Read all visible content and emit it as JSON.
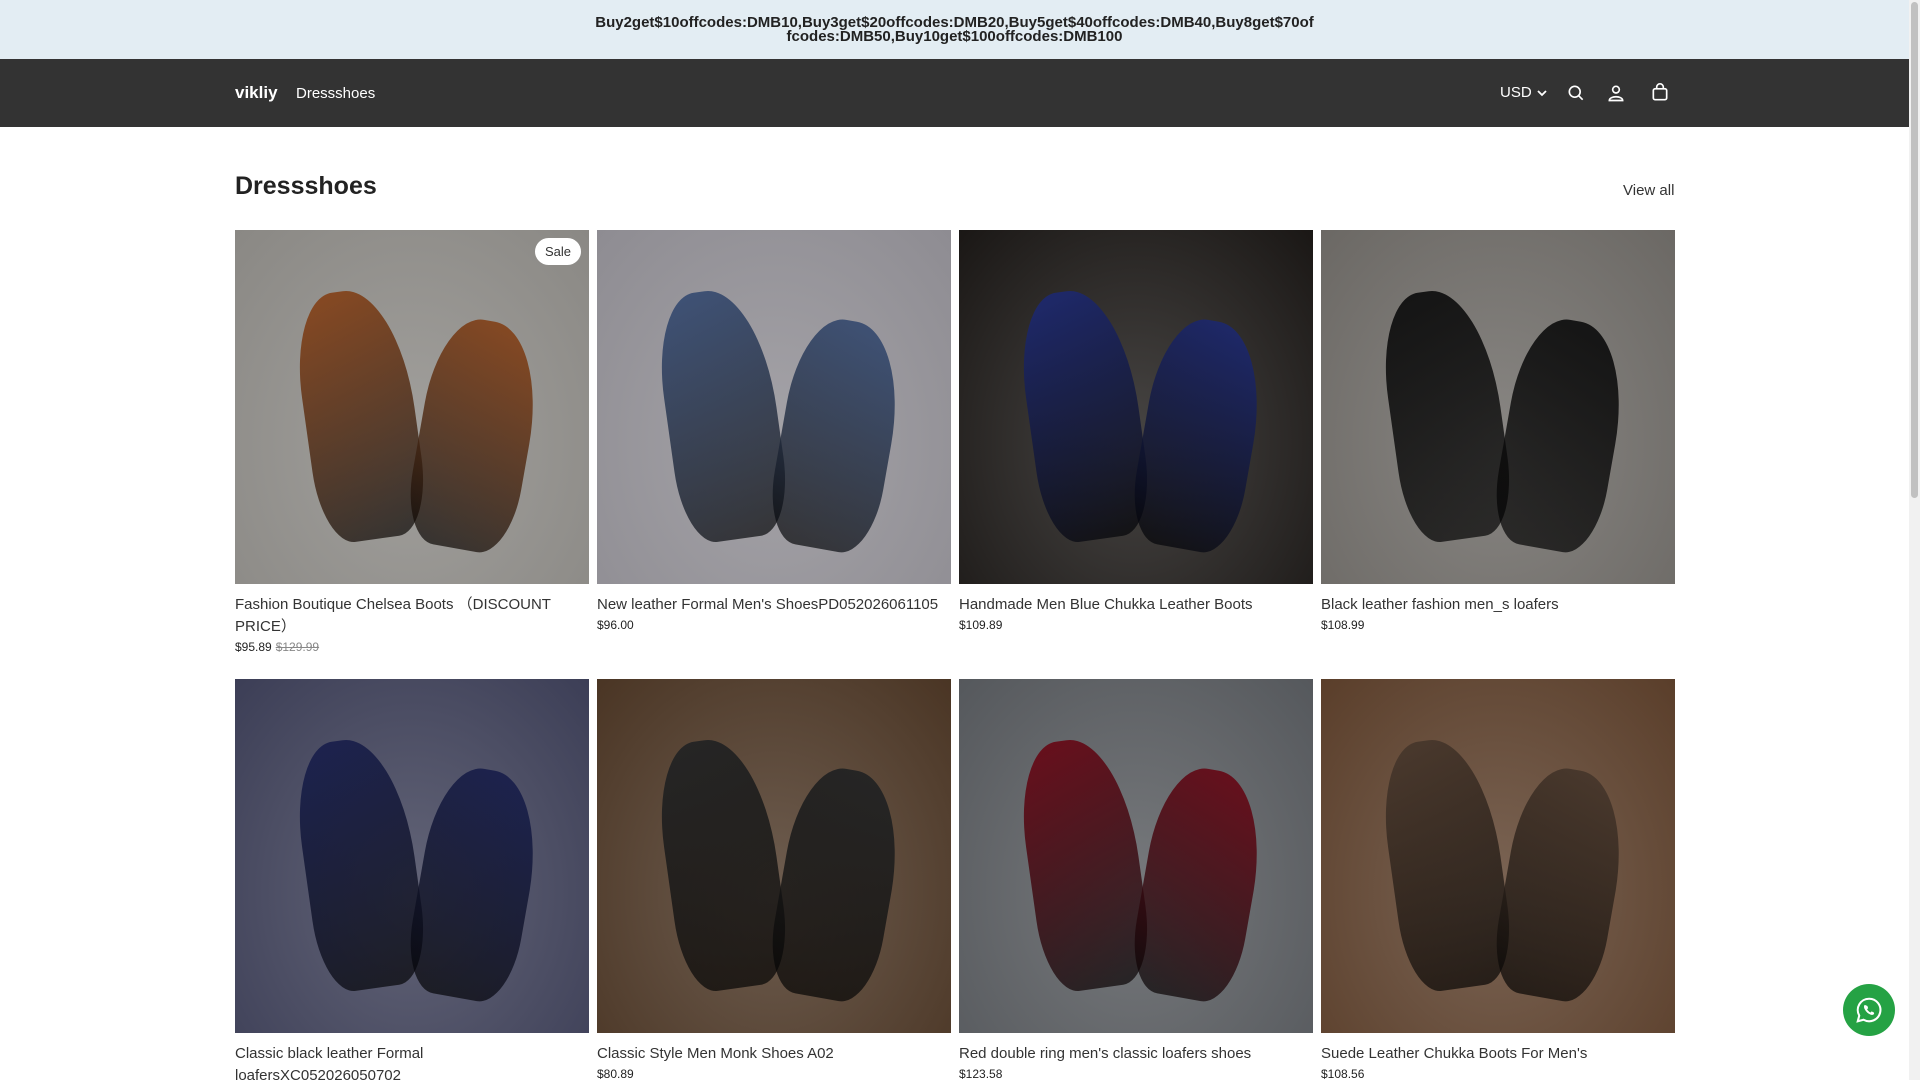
{
  "announcement": {
    "text": "Buy2get$10offcodes:DMB10,Buy3get$20offcodes:DMB20,Buy5get$40offcodes:DMB40,Buy8get$70offcodes:DMB50,Buy10get$100offcodes:DMB100"
  },
  "header": {
    "logo": "vikliy",
    "nav_link": "Dressshoes",
    "currency": "USD",
    "icons": [
      "search-icon",
      "account-icon",
      "cart-icon"
    ]
  },
  "section": {
    "title": "Dressshoes",
    "view_all": "View all"
  },
  "products": [
    {
      "title": "Fashion Boutique Chelsea Boots （DISCOUNT PRICE）",
      "price": "$95.89",
      "compare_price": "$129.99",
      "badge": "Sale",
      "bg": "#8a8884",
      "shoe": "#8a4a22"
    },
    {
      "title": "New leather Formal Men's ShoesPD052026061105",
      "price": "$96.00",
      "bg": "#8e8c92",
      "shoe": "#3f5378"
    },
    {
      "title": "Handmade Men Blue Chukka Leather Boots",
      "price": "$109.89",
      "bg": "#1a1715",
      "shoe": "#1f2a6e"
    },
    {
      "title": "Black leather fashion men_s loafers",
      "price": "$108.99",
      "bg": "#6b6864",
      "shoe": "#141414"
    },
    {
      "title": "Classic black leather Formal loafersXC052026050702",
      "price": "",
      "bg": "#3c3e56",
      "shoe": "#1d2350"
    },
    {
      "title": "Classic Style Men Monk Shoes A02",
      "price": "$80.89",
      "bg": "#4a3524",
      "shoe": "#262626"
    },
    {
      "title": "Red double ring men's classic loafers shoes",
      "price": "$123.58",
      "bg": "#55585c",
      "shoe": "#6a0f1c"
    },
    {
      "title": "Suede Leather Chukka Boots For Men's",
      "price": "$108.56",
      "bg": "#5a3e2a",
      "shoe": "#4b3a2e"
    }
  ]
}
